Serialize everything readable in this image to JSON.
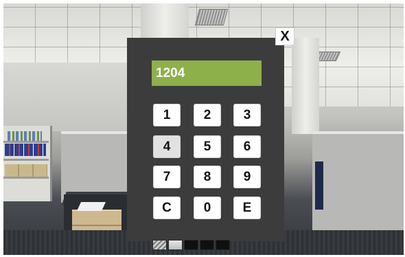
{
  "keypad": {
    "display_value": "1204",
    "keys": [
      "1",
      "2",
      "3",
      "4",
      "5",
      "6",
      "7",
      "8",
      "9",
      "C",
      "0",
      "E"
    ],
    "pressed_key": "4",
    "close_label": "X"
  },
  "colors": {
    "display_bg": "#8db04b",
    "dialog_bg": "#3c3c3c",
    "key_bg": "#ffffff"
  }
}
